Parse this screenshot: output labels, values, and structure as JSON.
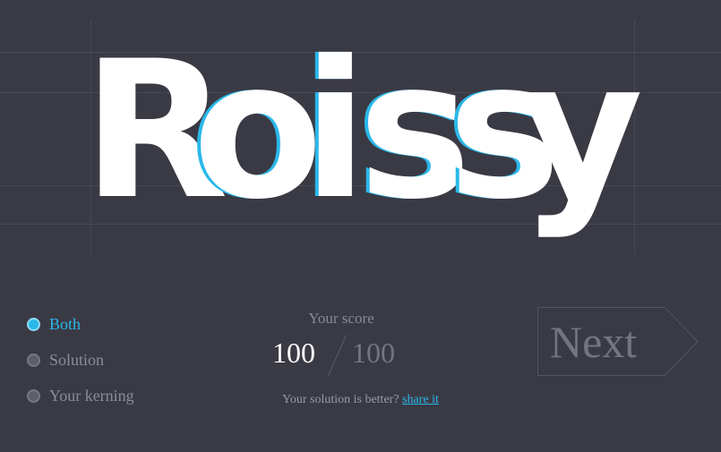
{
  "word": {
    "letters": [
      "R",
      "o",
      "i",
      "s",
      "s",
      "y"
    ]
  },
  "options": {
    "both_label": "Both",
    "solution_label": "Solution",
    "kerning_label": "Your kerning",
    "selected": "Both"
  },
  "score": {
    "title": "Your score",
    "value": "100",
    "total": "100"
  },
  "share": {
    "prompt": "Your solution is better?",
    "link_label": "share it"
  },
  "next_button": {
    "label": "Next"
  },
  "colors": {
    "background": "#3a3a45",
    "accent": "#2bb8ea",
    "letter": "#ffffff",
    "muted_text": "#8c8c96"
  }
}
